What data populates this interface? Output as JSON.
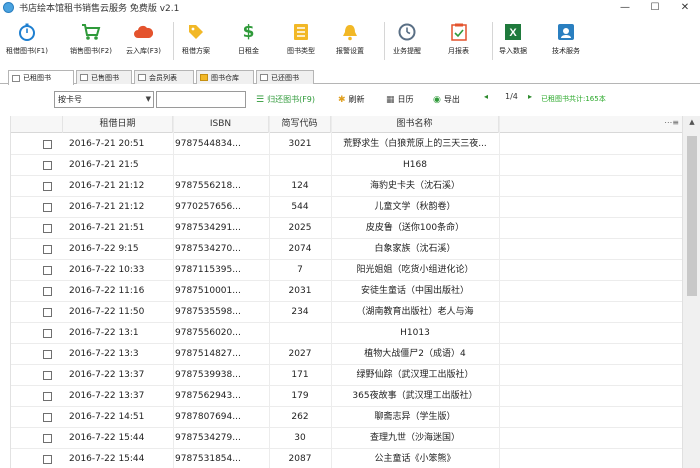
{
  "window": {
    "title": "书店绘本馆租书销售云服务 免费版 v2.1",
    "controls": [
      "—",
      "☐",
      "✕"
    ]
  },
  "toolbar": {
    "items": [
      {
        "label": "租借图书(F1)",
        "icon": "stopwatch-icon"
      },
      {
        "label": "销售图书(F2)",
        "icon": "cart-icon"
      },
      {
        "label": "云入库(F3)",
        "icon": "cloud-icon"
      },
      {
        "label": "租借方案",
        "icon": "tag-icon"
      },
      {
        "label": "日租金",
        "icon": "dollar-icon"
      },
      {
        "label": "图书类型",
        "icon": "book-type-icon"
      },
      {
        "label": "报警设置",
        "icon": "bell-icon"
      },
      {
        "label": "业务提醒",
        "icon": "clock-icon"
      },
      {
        "label": "月报表",
        "icon": "report-icon"
      },
      {
        "label": "导入数据",
        "icon": "excel-icon"
      },
      {
        "label": "技术服务",
        "icon": "support-icon"
      }
    ]
  },
  "tabs": [
    {
      "label": "已租图书",
      "active": true
    },
    {
      "label": "已售图书",
      "active": false
    },
    {
      "label": "会员列表",
      "active": false
    },
    {
      "label": "图书仓库",
      "active": false
    },
    {
      "label": "已还图书",
      "active": false
    }
  ],
  "filter": {
    "select_value": "按卡号",
    "search_value": "",
    "return_label": "归还图书(F9)",
    "refresh_label": "刷新",
    "calendar_label": "日历",
    "export_label": "导出",
    "prev": "◂",
    "page": "1/4",
    "next": "▸",
    "summary": "已租图书共计:165本"
  },
  "table": {
    "columns": [
      "租借日期",
      "ISBN",
      "简写代码",
      "图书名称"
    ],
    "rows": [
      {
        "date": "2016-7-21 20:51",
        "isbn": "9787544834...",
        "code": "3021",
        "name": "荒野求生（白狼荒原上的三天三夜..."
      },
      {
        "date": "2016-7-21 21:5",
        "isbn": "",
        "code": "",
        "name": "H168"
      },
      {
        "date": "2016-7-21 21:12",
        "isbn": "9787556218...",
        "code": "124",
        "name": "海豹史卡夫（沈石溪）"
      },
      {
        "date": "2016-7-21 21:12",
        "isbn": "9770257656...",
        "code": "544",
        "name": "儿童文学（秋韵卷）"
      },
      {
        "date": "2016-7-21 21:51",
        "isbn": "9787534291...",
        "code": "2025",
        "name": "皮皮鲁（送你100条命）"
      },
      {
        "date": "2016-7-22 9:15",
        "isbn": "9787534270...",
        "code": "2074",
        "name": "白象家族（沈石溪）"
      },
      {
        "date": "2016-7-22 10:33",
        "isbn": "9787115395...",
        "code": "7",
        "name": "阳光姐姐（吃货小组进化论）"
      },
      {
        "date": "2016-7-22 11:16",
        "isbn": "9787510001...",
        "code": "2031",
        "name": "安徒生童话（中国出版社）"
      },
      {
        "date": "2016-7-22 11:50",
        "isbn": "9787535598...",
        "code": "234",
        "name": "（湖南教育出版社）老人与海"
      },
      {
        "date": "2016-7-22 13:1",
        "isbn": "9787556020...",
        "code": "",
        "name": "H1013"
      },
      {
        "date": "2016-7-22 13:3",
        "isbn": "9787514827...",
        "code": "2027",
        "name": "植物大战僵尸2（成语）4"
      },
      {
        "date": "2016-7-22 13:37",
        "isbn": "9787539938...",
        "code": "171",
        "name": "绿野仙踪（武汉理工出版社）"
      },
      {
        "date": "2016-7-22 13:37",
        "isbn": "9787562943...",
        "code": "179",
        "name": "365夜故事（武汉理工出版社）"
      },
      {
        "date": "2016-7-22 14:51",
        "isbn": "9787807694...",
        "code": "262",
        "name": "聊斋志异（学生版）"
      },
      {
        "date": "2016-7-22 15:44",
        "isbn": "9787534279...",
        "code": "30",
        "name": "查理九世（沙海迷国）"
      },
      {
        "date": "2016-7-22 15:44",
        "isbn": "9787531854...",
        "code": "2087",
        "name": "公主童话《小笨熊》"
      }
    ]
  },
  "colors": {
    "accent_green": "#2aa82a",
    "row_border": "#ececec"
  }
}
